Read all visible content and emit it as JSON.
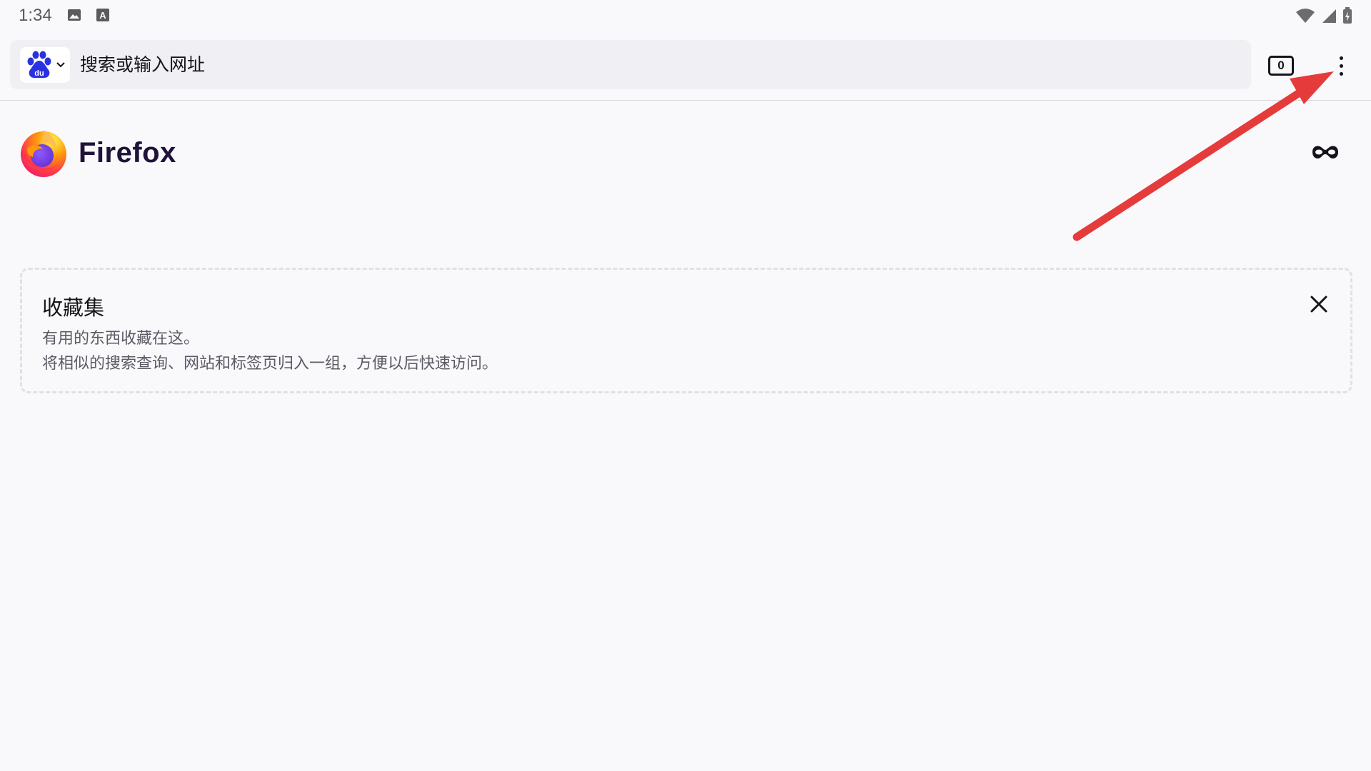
{
  "status_bar": {
    "time": "1:34",
    "left_icons": [
      "image-icon",
      "font-icon"
    ],
    "right_icons": [
      "wifi-icon",
      "signal-icon",
      "battery-icon"
    ]
  },
  "toolbar": {
    "search_engine": "baidu-logo-icon",
    "url_placeholder": "搜索或输入网址",
    "tab_count": "0",
    "menu_icon": "three-dot-menu-icon"
  },
  "header": {
    "wordmark": "Firefox",
    "private_browsing_icon": "mask-icon"
  },
  "collections": {
    "title": "收藏集",
    "line1": "有用的东西收藏在这。",
    "line2": "将相似的搜索查询、网站和标签页归入一组，方便以后快速访问。"
  },
  "colors": {
    "background": "#f9f9fb",
    "url_bar": "#f0f0f4",
    "annotation_arrow": "#e53b3b",
    "baidu_blue": "#2932e1"
  }
}
